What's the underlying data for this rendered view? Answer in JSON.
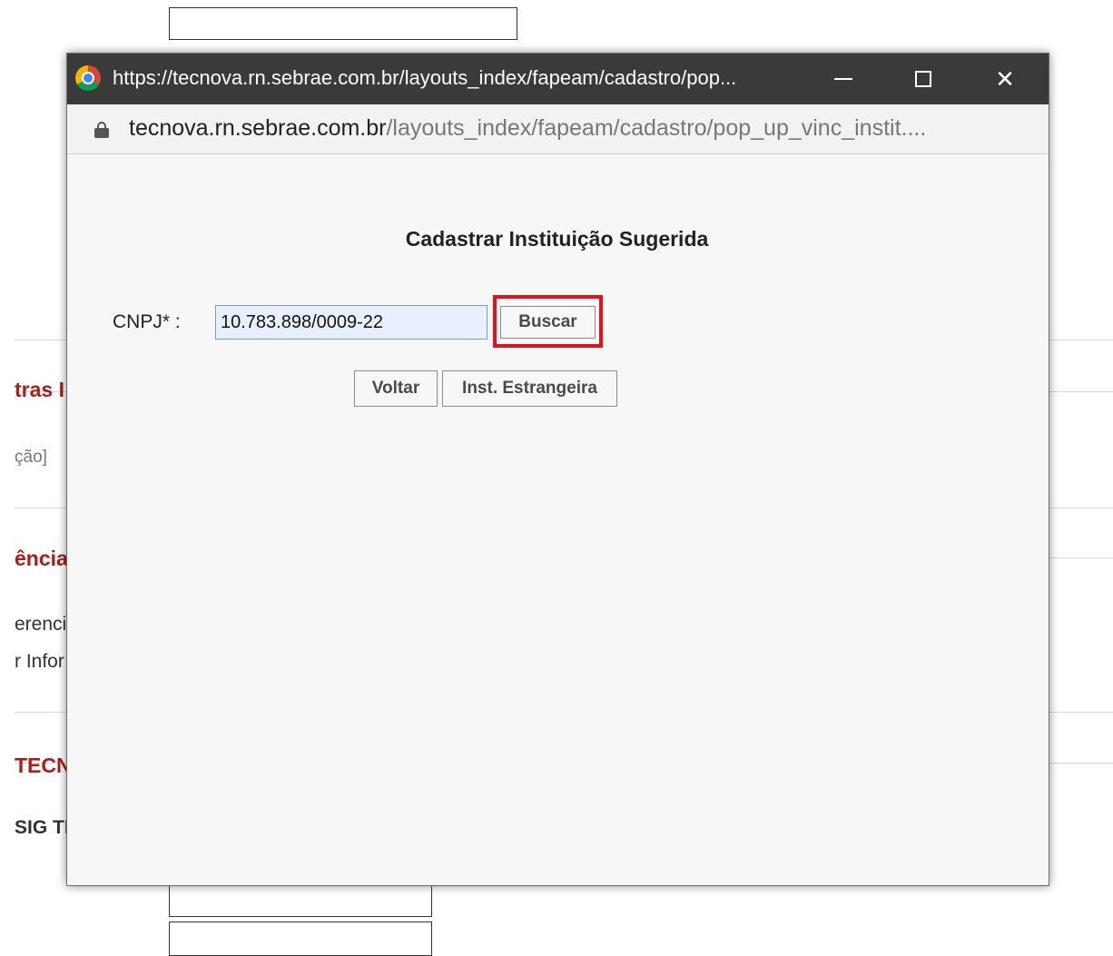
{
  "background": {
    "headings": [
      "tras I",
      "ência",
      "TECN"
    ],
    "texts": [
      "ção]",
      "erenci",
      "r Infor",
      "SIG TE"
    ]
  },
  "window": {
    "title": "https://tecnova.rn.sebrae.com.br/layouts_index/fapeam/cadastro/pop...",
    "minimize_icon": "minimize-icon",
    "maximize_icon": "maximize-icon",
    "close_icon": "close-icon",
    "close_glyph": "✕"
  },
  "address": {
    "domain": "tecnova.rn.sebrae.com.br",
    "path": "/layouts_index/fapeam/cadastro/pop_up_vinc_instit...."
  },
  "form": {
    "title": "Cadastrar Instituição Sugerida",
    "cnpj_label": "CNPJ* :",
    "cnpj_value": "10.783.898/0009-22",
    "buscar_label": "Buscar",
    "voltar_label": "Voltar",
    "estrangeira_label": "Inst. Estrangeira"
  },
  "colors": {
    "highlight": "#e0121b",
    "titlebar": "#3a3a3a",
    "heading_red": "#a8201a"
  }
}
